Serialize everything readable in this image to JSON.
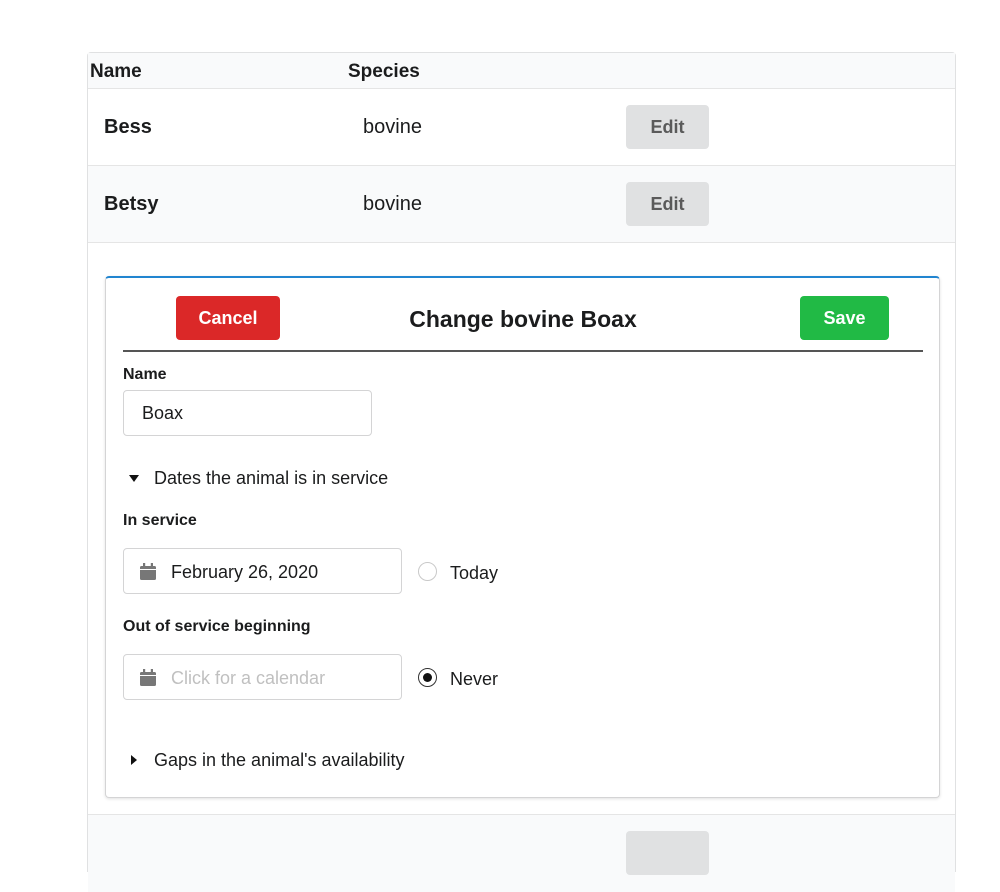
{
  "table": {
    "headers": {
      "name": "Name",
      "species": "Species"
    },
    "rows": [
      {
        "name": "Bess",
        "species": "bovine",
        "edit_label": "Edit"
      },
      {
        "name": "Betsy",
        "species": "bovine",
        "edit_label": "Edit"
      }
    ]
  },
  "edit_panel": {
    "title": "Change bovine Boax",
    "cancel_label": "Cancel",
    "save_label": "Save",
    "name_label": "Name",
    "name_value": "Boax",
    "dates_section_label": "Dates the animal is in service",
    "in_service_label": "In service",
    "in_service_value": "February 26, 2020",
    "today_label": "Today",
    "today_checked": false,
    "out_of_service_label": "Out of service beginning",
    "out_of_service_placeholder": "Click for a calendar",
    "never_label": "Never",
    "never_checked": true,
    "gaps_section_label": "Gaps in the animal's availability"
  },
  "colors": {
    "cancel": "#db2828",
    "save": "#21ba45",
    "accent_border": "#2185d0",
    "edit_button": "#e0e1e2"
  },
  "icons": {
    "date_field": "calendar-icon",
    "dates_toggle": "triangle-down-icon",
    "gaps_toggle": "triangle-right-icon"
  }
}
